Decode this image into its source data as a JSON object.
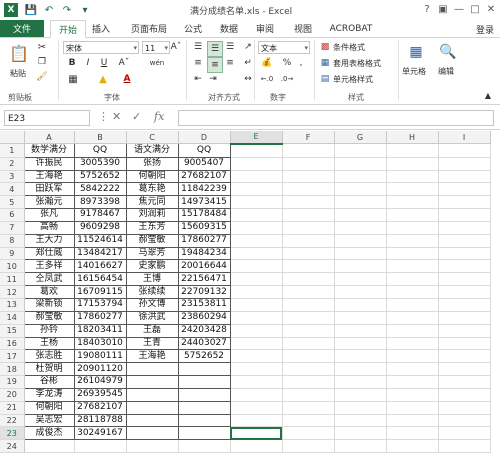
{
  "window": {
    "title": "满分成绩名单.xls - Excel",
    "login": "登录"
  },
  "tabs": [
    "文件",
    "开始",
    "插入",
    "页面布局",
    "公式",
    "数据",
    "审阅",
    "视图",
    "ACROBAT"
  ],
  "ribbon": {
    "font_name": "宋体",
    "font_size": "11",
    "number_format": "文本",
    "groups": {
      "clipboard": "剪贴板",
      "font": "字体",
      "alignment": "对齐方式",
      "number": "数字",
      "styles": "样式"
    },
    "paste_label": "粘贴",
    "conditional_format": "条件格式",
    "table_format": "套用表格格式",
    "cell_styles": "单元格样式",
    "cells_label": "单元格",
    "edit_label": "编辑",
    "percent": "%",
    "comma": ",",
    "wen": "wén"
  },
  "formula_bar": {
    "name_box": "E23",
    "fx": "fx",
    "value": ""
  },
  "sheet": {
    "columns": [
      "A",
      "B",
      "C",
      "D",
      "E",
      "F",
      "G",
      "H",
      "I"
    ],
    "selected_cell": "E23",
    "rows": [
      [
        "数学满分",
        "QQ",
        "语文满分",
        "QQ"
      ],
      [
        "许振民",
        "3005390",
        "张扬",
        "9005407"
      ],
      [
        "王海艳",
        "5752652",
        "何朝阳",
        "27682107"
      ],
      [
        "田跃军",
        "5842222",
        "葛东艳",
        "11842239"
      ],
      [
        "张瀚元",
        "8973398",
        "焦元同",
        "14973415"
      ],
      [
        "张凡",
        "9178467",
        "刘润莉",
        "15178484"
      ],
      [
        "高畅",
        "9609298",
        "王东芳",
        "15609315"
      ],
      [
        "王大力",
        "11524614",
        "郝莹敏",
        "17860277"
      ],
      [
        "郑仕威",
        "13484217",
        "马翠芳",
        "19484234"
      ],
      [
        "王多祥",
        "14016627",
        "史家鹏",
        "20016644"
      ],
      [
        "仝凤武",
        "16156454",
        "王博",
        "22156471"
      ],
      [
        "葛欢",
        "16709115",
        "张续续",
        "22709132"
      ],
      [
        "梁新锁",
        "17153794",
        "孙文博",
        "23153811"
      ],
      [
        "郝莹敏",
        "17860277",
        "徐洪武",
        "23860294"
      ],
      [
        "孙钤",
        "18203411",
        "王磊",
        "24203428"
      ],
      [
        "王杨",
        "18403010",
        "王青",
        "24403027"
      ],
      [
        "张志胜",
        "19080111",
        "王海艳",
        "5752652"
      ],
      [
        "杜贺明",
        "20901120",
        "",
        ""
      ],
      [
        "谷彬",
        "26104979",
        "",
        ""
      ],
      [
        "李龙涛",
        "26939545",
        "",
        ""
      ],
      [
        "何朝阳",
        "27682107",
        "",
        ""
      ],
      [
        "吴志宏",
        "28118788",
        "",
        ""
      ],
      [
        "成俊杰",
        "30249167",
        "",
        ""
      ]
    ],
    "extra_row": "24"
  },
  "colors": {
    "accent": "#217346",
    "header_bg": "#f3f3f3",
    "grid": "#dadada"
  }
}
